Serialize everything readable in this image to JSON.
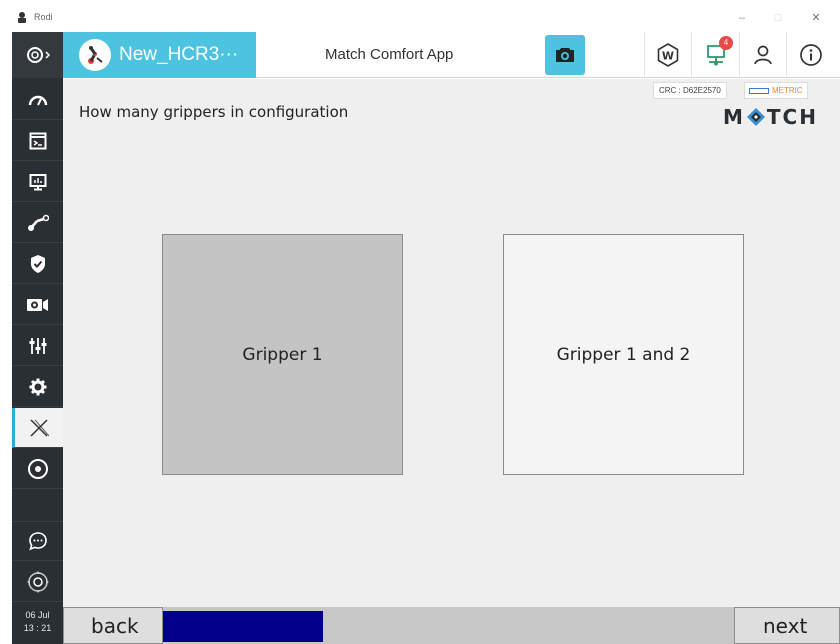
{
  "window": {
    "title": "Rodi",
    "controls": [
      "–",
      "□",
      "✕"
    ]
  },
  "header": {
    "robot_name": "New_HCR3···",
    "app_title": "Match Comfort App",
    "notification_count": "4",
    "icons": [
      "camera-icon",
      "w-badge-icon",
      "network-icon",
      "user-icon",
      "info-icon"
    ]
  },
  "sidebar": {
    "items": [
      "dashboard-icon",
      "terminal-icon",
      "monitor-icon",
      "robot-arm-icon",
      "shield-icon",
      "camera-record-icon",
      "sliders-icon",
      "gear-icon",
      "x-app-icon",
      "disc-icon",
      "chat-icon",
      "joystick-icon"
    ],
    "active_item": "x-app-icon",
    "date": "06 Jul",
    "time": "13 : 21"
  },
  "status": {
    "crc": "CRC : D62E2570",
    "unit": "METRIC"
  },
  "logo_text": [
    "M",
    "TCH"
  ],
  "question": "How many grippers in configuration",
  "choices": [
    {
      "label": "Gripper 1",
      "selected": true
    },
    {
      "label": "Gripper 1 and 2",
      "selected": false
    }
  ],
  "footer": {
    "back_label": "back",
    "next_label": "next",
    "progress": 0.28
  },
  "colors": {
    "accent": "#4cc3df",
    "sidebar_bg": "#2a2f33",
    "progress_fill": "#00008b",
    "badge": "#e84a4a",
    "metric_text": "#e8872f"
  }
}
